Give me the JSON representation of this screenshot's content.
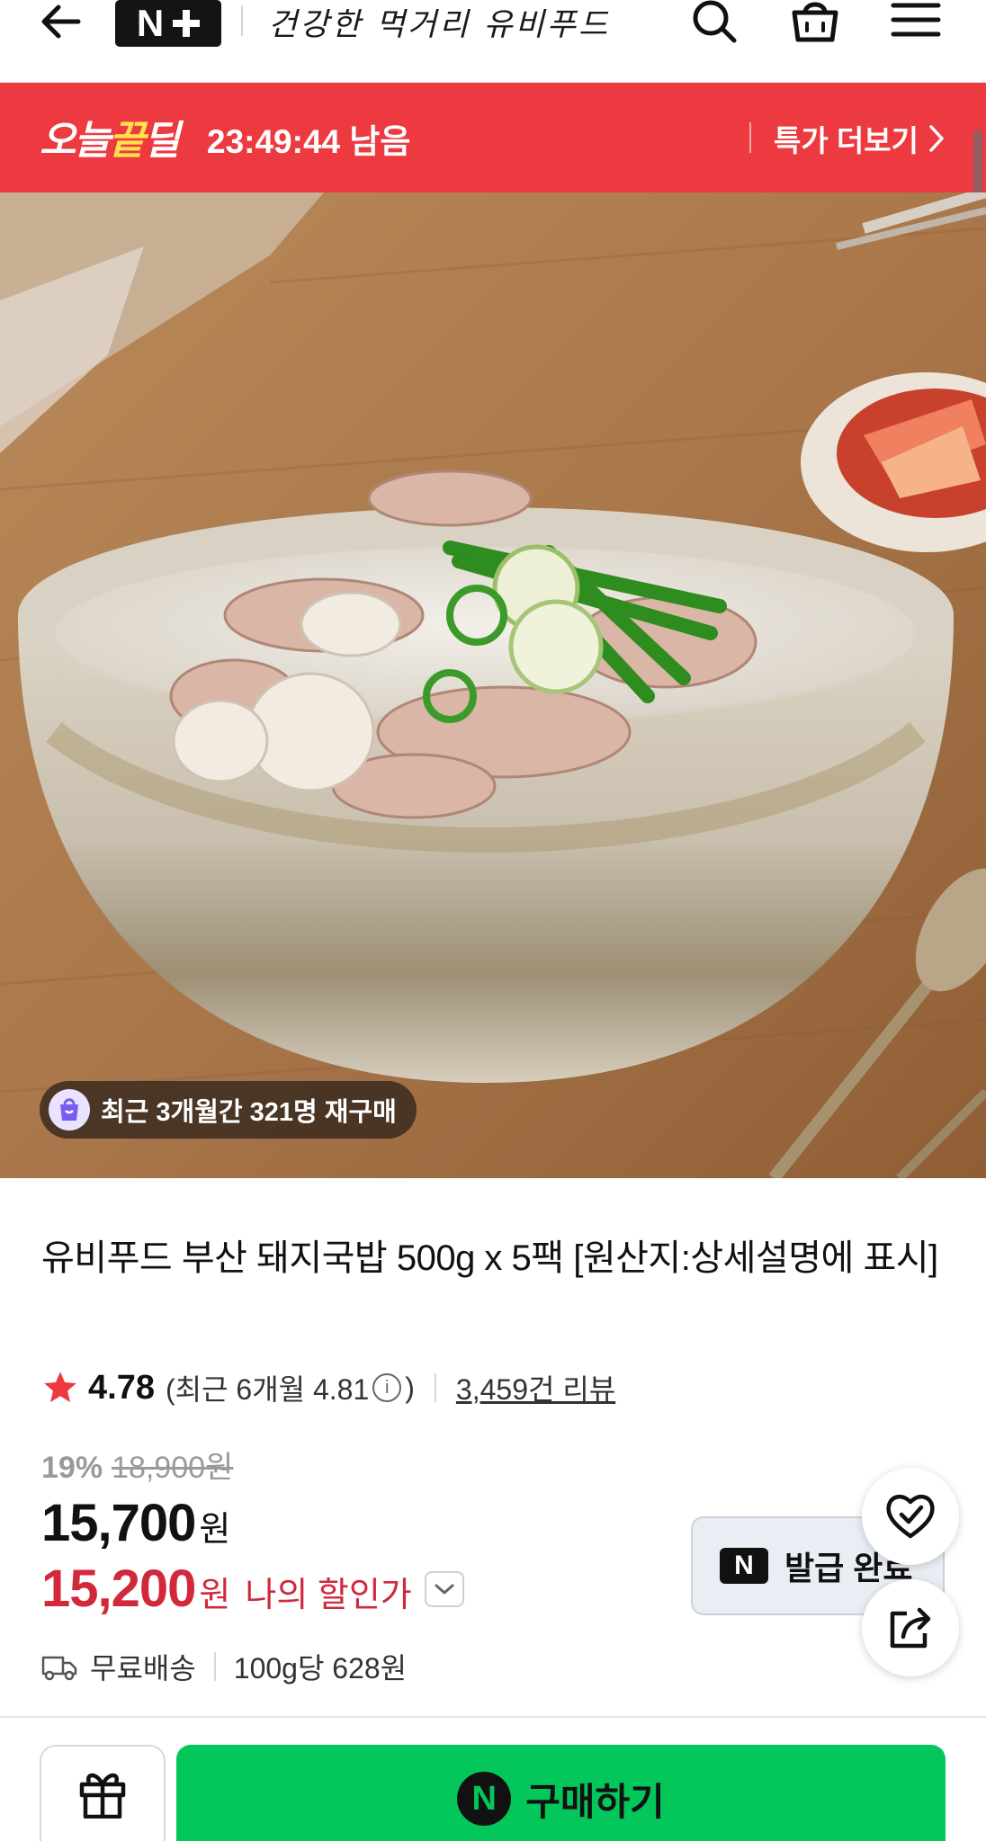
{
  "header": {
    "store_name": "건강한 먹거리 유비푸드",
    "logo_text": "N",
    "icons": [
      "back-arrow-icon",
      "search-icon",
      "cart-icon",
      "menu-icon"
    ]
  },
  "deal_banner": {
    "logo_prefix": "오늘",
    "logo_highlight": "끝",
    "logo_suffix": "딜",
    "timer": "23:49:44 남음",
    "more_label": "특가 더보기",
    "background_color": "#ed3a40"
  },
  "hero": {
    "repurchase_badge": "최근 3개월간 321명 재구매"
  },
  "product": {
    "title": "유비푸드 부산 돼지국밥 500g x 5팩 [원산지:상세설명에 표시]",
    "rating": "4.78",
    "recent_rating": "(최근 6개월 4.81",
    "recent_rating_close": ")",
    "review_count": "3,459건 리뷰",
    "discount_percent": "19%",
    "original_price": "18,900원",
    "price": "15,700",
    "price_unit": "원",
    "my_price": "15,200",
    "my_price_unit": "원",
    "my_price_label": "나의 할인가",
    "coupon_label": "발급 완료",
    "coupon_mark": "N",
    "shipping": "무료배송",
    "unit_price": "100g당 628원",
    "accent_red": "#d1283c"
  },
  "bottom_bar": {
    "buy_label": "구매하기",
    "buy_mark": "N",
    "buy_color": "#03c75a"
  }
}
